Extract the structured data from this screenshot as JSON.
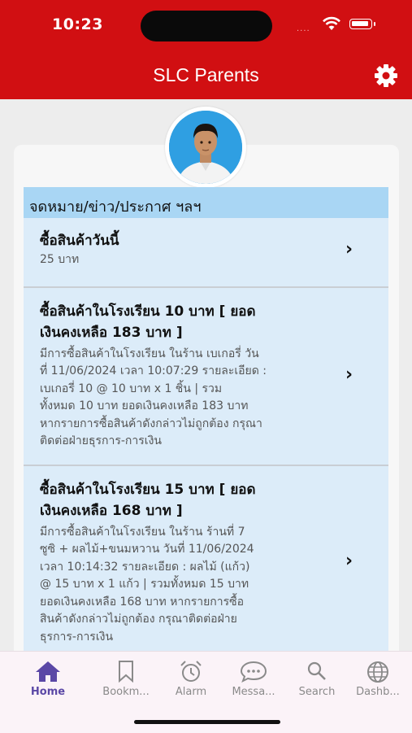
{
  "status_bar": {
    "time": "10:23",
    "signal": "...."
  },
  "header": {
    "title": "SLC Parents"
  },
  "section": {
    "title": "จดหมาย/ข่าว/ประกาศ ฯลฯ"
  },
  "items": [
    {
      "title_lines": [
        "ซื้อสินค้าวันนี้"
      ],
      "desc_lines": [
        "25 บาท"
      ]
    },
    {
      "title_lines": [
        "ซื้อสินค้าในโรงเรียน 10 บาท  [ ยอด",
        "เงินคงเหลือ 183 บาท ]"
      ],
      "desc_lines": [
        "มีการซื้อสินค้าในโรงเรียน ในร้าน  เบเกอรี่ วัน",
        "ที่ 11/06/2024 เวลา 10:07:29 รายละเอียด :",
        "เบเกอรี่ 10  @ 10 บาท x  1  ชิ้น  | รวม",
        "ทั้งหมด 10  บาท ยอดเงินคงเหลือ 183 บาท",
        "หากรายการซื้อสินค้าดังกล่าวไม่ถูกต้อง กรุณา",
        "ติดต่อฝ่ายธุรการ-การเงิน"
      ]
    },
    {
      "title_lines": [
        "ซื้อสินค้าในโรงเรียน 15 บาท  [ ยอด",
        "เงินคงเหลือ 168 บาท ]"
      ],
      "desc_lines": [
        "มีการซื้อสินค้าในโรงเรียน ในร้าน  ร้านที่ 7",
        "ซูซิ + ผลไม้+ขนมหวาน วันที่ 11/06/2024",
        "เวลา 10:14:32 รายละเอียด : ผลไม้ (แก้ว)",
        "@ 15 บาท x  1  แก้ว  | รวมทั้งหมด 15  บาท",
        "ยอดเงินคงเหลือ 168 บาท หากรายการซื้อ",
        "สินค้าดังกล่าวไม่ถูกต้อง กรุณาติดต่อฝ่าย",
        "ธุรการ-การเงิน"
      ]
    }
  ],
  "tabs": [
    {
      "label": "Home",
      "icon": "home-icon",
      "active": true
    },
    {
      "label": "Bookm...",
      "icon": "bookmark-icon",
      "active": false
    },
    {
      "label": "Alarm",
      "icon": "alarm-icon",
      "active": false
    },
    {
      "label": "Messa...",
      "icon": "message-icon",
      "active": false
    },
    {
      "label": "Search",
      "icon": "search-icon",
      "active": false
    },
    {
      "label": "Dashb...",
      "icon": "globe-icon",
      "active": false
    }
  ],
  "colors": {
    "header_red": "#d10f12",
    "section_blue": "#a9d6f4",
    "item_blue": "#dcecf9",
    "tab_active": "#5b48a6"
  }
}
